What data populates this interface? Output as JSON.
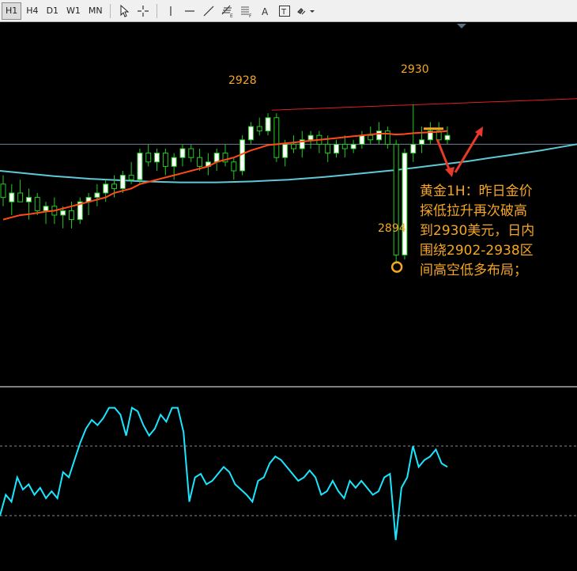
{
  "toolbar": {
    "timeframes": [
      "H1",
      "H4",
      "D1",
      "W1",
      "MN"
    ],
    "active_timeframe": "H1",
    "tools": [
      "cursor-icon",
      "crosshair-icon",
      "vertical-line-icon",
      "horizontal-line-icon",
      "trendline-icon",
      "fibonacci-icon",
      "channel-icon",
      "text-icon",
      "text-label-icon",
      "shapes-dropdown-icon"
    ],
    "tool_badges": {
      "fibonacci": "E",
      "channel": "F",
      "text": "A",
      "text_label": "T"
    }
  },
  "annotations": {
    "high1": "2928",
    "high2": "2930",
    "low": "2894",
    "comment_lines": [
      "黄金1H：昨日金价",
      "探低拉升再次破高",
      "到2930美元，日内",
      "围绕2902-2938区",
      "间高空低多布局；"
    ]
  },
  "colors": {
    "background": "#000000",
    "bull_candle": "#ffffff",
    "bear_candle": "#000000",
    "candle_wick": "#22cc22",
    "ma_fast": "#ff4a1a",
    "ma_slow": "#5fc8d6",
    "trendline": "#e02020",
    "oscillator": "#19e6ff",
    "annotation": "#f5a623",
    "arrow": "#e83a2a"
  },
  "chart_data": {
    "type": "candlestick",
    "symbol_note": "gold 1H",
    "price_axis_visible": false,
    "ylim": [
      2870,
      2945
    ],
    "candles": [
      [
        2912,
        2914,
        2907,
        2909
      ],
      [
        2908,
        2912,
        2905,
        2910
      ],
      [
        2910,
        2913,
        2908,
        2908
      ],
      [
        2908,
        2911,
        2904,
        2909
      ],
      [
        2909,
        2910,
        2905,
        2906
      ],
      [
        2906,
        2908,
        2903,
        2907
      ],
      [
        2907,
        2909,
        2903,
        2905
      ],
      [
        2905,
        2907,
        2902,
        2906
      ],
      [
        2906,
        2908,
        2902,
        2904
      ],
      [
        2904,
        2909,
        2903,
        2908
      ],
      [
        2908,
        2910,
        2905,
        2909
      ],
      [
        2909,
        2912,
        2907,
        2910
      ],
      [
        2910,
        2913,
        2908,
        2912
      ],
      [
        2912,
        2914,
        2909,
        2911
      ],
      [
        2911,
        2915,
        2910,
        2914
      ],
      [
        2914,
        2917,
        2912,
        2913
      ],
      [
        2913,
        2920,
        2912,
        2919
      ],
      [
        2919,
        2921,
        2916,
        2917
      ],
      [
        2917,
        2920,
        2915,
        2919
      ],
      [
        2919,
        2920,
        2914,
        2916
      ],
      [
        2916,
        2919,
        2913,
        2918
      ],
      [
        2918,
        2921,
        2916,
        2920
      ],
      [
        2920,
        2921,
        2917,
        2918
      ],
      [
        2918,
        2920,
        2915,
        2916
      ],
      [
        2916,
        2919,
        2914,
        2917
      ],
      [
        2917,
        2920,
        2915,
        2919
      ],
      [
        2919,
        2921,
        2916,
        2917
      ],
      [
        2917,
        2918,
        2913,
        2915
      ],
      [
        2915,
        2923,
        2914,
        2922
      ],
      [
        2922,
        2926,
        2921,
        2925
      ],
      [
        2925,
        2927,
        2923,
        2924
      ],
      [
        2924,
        2928,
        2923,
        2927
      ],
      [
        2927,
        2928,
        2917,
        2918
      ],
      [
        2918,
        2922,
        2916,
        2921
      ],
      [
        2921,
        2923,
        2919,
        2920
      ],
      [
        2920,
        2924,
        2918,
        2922
      ],
      [
        2922,
        2924,
        2920,
        2923
      ],
      [
        2923,
        2924,
        2919,
        2921
      ],
      [
        2921,
        2923,
        2917,
        2919
      ],
      [
        2919,
        2922,
        2918,
        2921
      ],
      [
        2921,
        2923,
        2918,
        2920
      ],
      [
        2920,
        2922,
        2919,
        2921
      ],
      [
        2921,
        2924,
        2920,
        2923
      ],
      [
        2923,
        2925,
        2921,
        2922
      ],
      [
        2922,
        2926,
        2921,
        2924
      ],
      [
        2924,
        2925,
        2920,
        2921
      ],
      [
        2921,
        2922,
        2894,
        2896
      ],
      [
        2896,
        2920,
        2895,
        2919
      ],
      [
        2919,
        2930,
        2917,
        2921
      ],
      [
        2921,
        2925,
        2919,
        2922
      ],
      [
        2922,
        2926,
        2921,
        2924
      ],
      [
        2924,
        2926,
        2921,
        2922
      ],
      [
        2922,
        2925,
        2921,
        2923
      ]
    ],
    "ma_fast": [
      2904,
      2904.5,
      2905,
      2905.2,
      2905.5,
      2905.8,
      2906,
      2906.5,
      2907,
      2907.5,
      2908,
      2908.5,
      2909,
      2910,
      2910.5,
      2911,
      2912,
      2912.5,
      2913,
      2913.5,
      2914,
      2914.5,
      2915,
      2915.5,
      2916,
      2917,
      2917.5,
      2918,
      2918.8,
      2919.6,
      2920.2,
      2920.8,
      2921,
      2921.2,
      2921.4,
      2921.6,
      2921.8,
      2922,
      2922.2,
      2922.4,
      2922.6,
      2922.8,
      2923,
      2923.2,
      2923.4,
      2923.4,
      2923.2,
      2923.3,
      2923.5,
      2923.6,
      2923.7,
      2923.8,
      2924
    ],
    "ma_slow": [
      2915,
      2914.6,
      2914.2,
      2913.8,
      2913.5,
      2913.2,
      2913,
      2912.8,
      2912.6,
      2912.5,
      2912.4,
      2912.4,
      2912.4,
      2912.5,
      2912.6,
      2912.8,
      2913,
      2913.3,
      2913.6,
      2914,
      2914.4,
      2914.8,
      2915.2,
      2915.7,
      2916.2,
      2916.7,
      2917.2,
      2917.8,
      2918.4,
      2919,
      2919.6,
      2920.3,
      2921
    ],
    "ma_slow_start_index": 0,
    "trendline": {
      "from": 2928,
      "to": 2932
    },
    "oscillator": {
      "ylim": [
        0,
        100
      ],
      "levels": [
        70,
        30
      ],
      "values": [
        30,
        42,
        38,
        52,
        45,
        48,
        42,
        46,
        40,
        44,
        40,
        55,
        52,
        62,
        72,
        80,
        85,
        82,
        86,
        92,
        92,
        88,
        76,
        92,
        90,
        82,
        76,
        80,
        88,
        84,
        92,
        92,
        78,
        38,
        52,
        54,
        48,
        50,
        54,
        58,
        55,
        48,
        45,
        42,
        38,
        50,
        52,
        60,
        64,
        62,
        58,
        54,
        50,
        52,
        56,
        52,
        42,
        44,
        50,
        44,
        40,
        50,
        46,
        50,
        46,
        42,
        44,
        52,
        54,
        16,
        46,
        52,
        70,
        58,
        62,
        64,
        68,
        60,
        58
      ]
    },
    "markers": {
      "high1": {
        "value": 2928,
        "label": "2928"
      },
      "high2": {
        "value": 2930,
        "label": "2930"
      },
      "low": {
        "value": 2894,
        "label": "2894"
      },
      "resistance_dash": 2924.5,
      "current_price_line": 2921
    },
    "projection": [
      "down",
      "up"
    ]
  }
}
